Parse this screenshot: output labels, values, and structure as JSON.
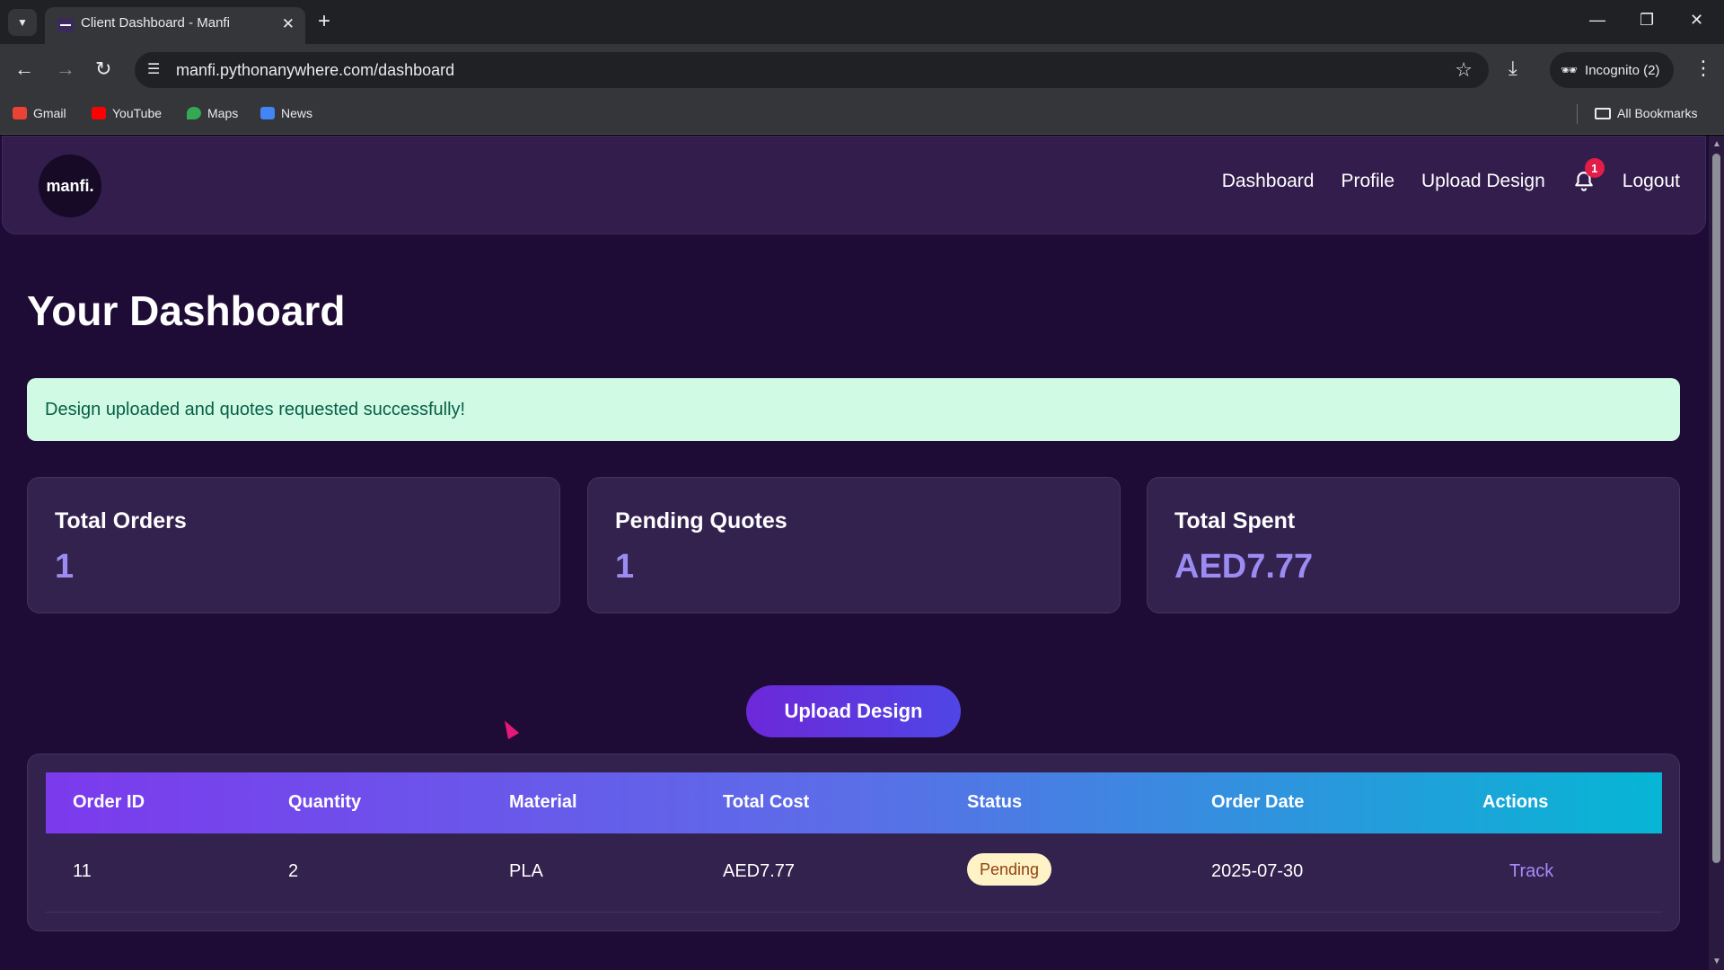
{
  "browser": {
    "tab_title": "Client Dashboard - Manfi",
    "url": "manfi.pythonanywhere.com/dashboard",
    "incognito_label": "Incognito (2)",
    "bookmarks": [
      "Gmail",
      "YouTube",
      "Maps",
      "News"
    ],
    "all_bookmarks": "All Bookmarks"
  },
  "nav": {
    "logo": "manfi.",
    "links": [
      "Dashboard",
      "Profile",
      "Upload Design"
    ],
    "notification_count": "1",
    "logout": "Logout"
  },
  "page": {
    "title": "Your Dashboard",
    "alert": "Design uploaded and quotes requested successfully!"
  },
  "stats": [
    {
      "label": "Total Orders",
      "value": "1"
    },
    {
      "label": "Pending Quotes",
      "value": "1"
    },
    {
      "label": "Total Spent",
      "value": "AED7.77"
    }
  ],
  "upload_button": "Upload Design",
  "table": {
    "headers": [
      "Order ID",
      "Quantity",
      "Material",
      "Total Cost",
      "Status",
      "Order Date",
      "Actions"
    ],
    "rows": [
      {
        "order_id": "11",
        "quantity": "2",
        "material": "PLA",
        "total_cost": "AED7.77",
        "status": "Pending",
        "order_date": "2025-07-30",
        "action": "Track"
      }
    ]
  },
  "colors": {
    "page_bg": "#1f0c36",
    "card_bg": "#33214e",
    "accent": "#9c8cf2",
    "alert_bg": "#d1fae5",
    "badge_bg": "#fef3c7"
  }
}
